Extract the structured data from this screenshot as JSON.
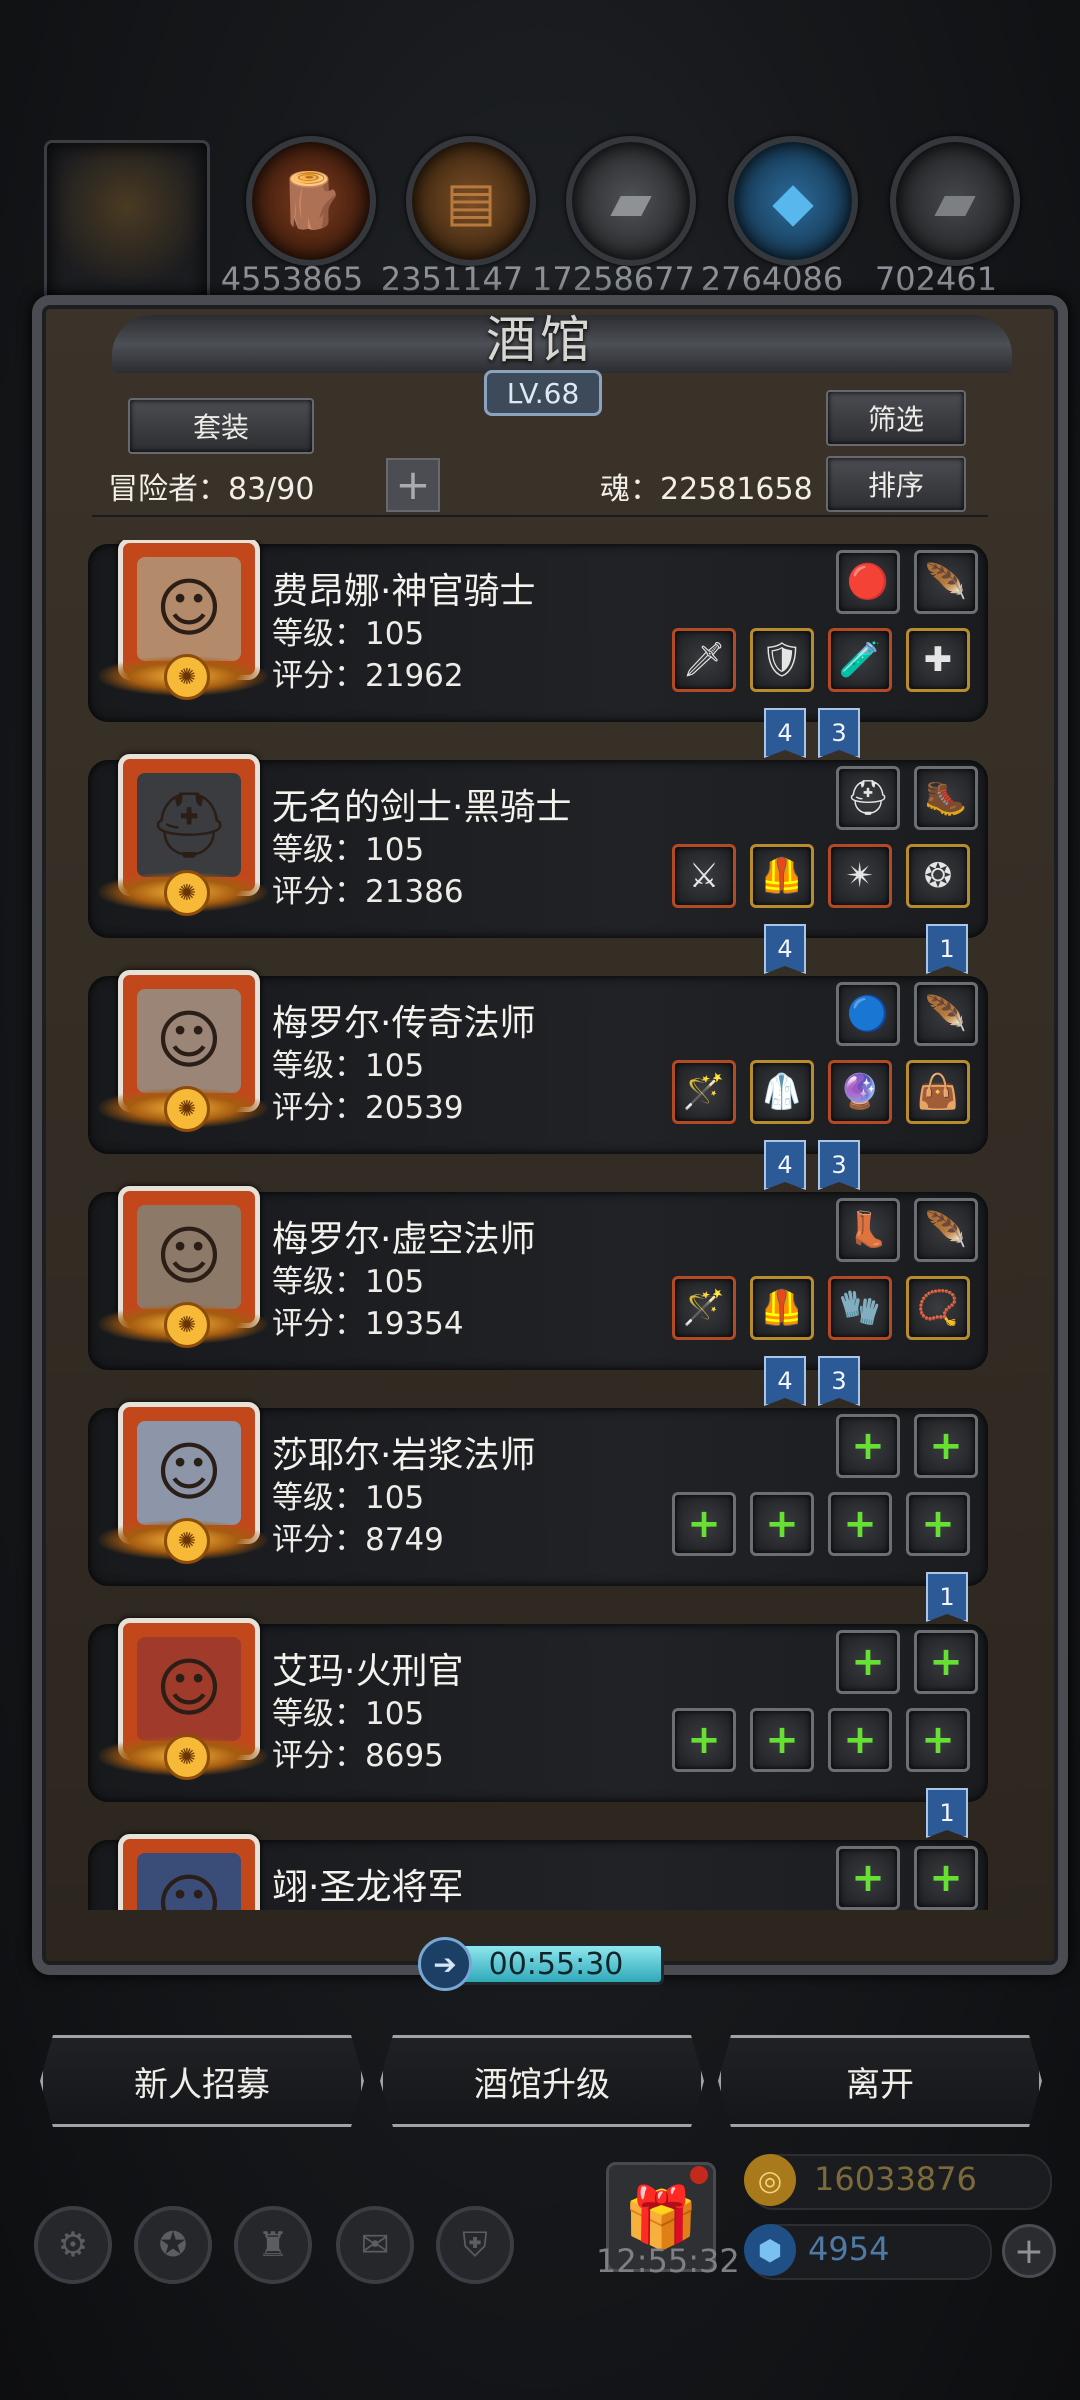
{
  "top_resources": [
    {
      "icon": "wood-icon",
      "glyph": "🪵",
      "value": "4553865"
    },
    {
      "icon": "plank-icon",
      "glyph": "▤",
      "value": "2351147"
    },
    {
      "icon": "iron-bar-icon",
      "glyph": "▰",
      "value": "17258677"
    },
    {
      "icon": "crystal-icon",
      "glyph": "◆",
      "value": "2764086"
    },
    {
      "icon": "steel-icon",
      "glyph": "▰",
      "value": "702461"
    }
  ],
  "tavern": {
    "title": "酒馆",
    "level": "LV.68",
    "set_button": "套装",
    "filter_button": "筛选",
    "sort_button": "排序",
    "adventurer_label": "冒险者：83/90",
    "soul_label": "魂：22581658"
  },
  "heroes": [
    {
      "name": "费昂娜·神官骑士",
      "level": "等级：105",
      "score": "评分：21962",
      "top_slots": [
        "🔴",
        "🪶",
        "💜"
      ],
      "bottom_slots": [
        "🗡",
        "🛡",
        "🧪",
        "✚"
      ],
      "tags": [
        "4",
        "3",
        ""
      ]
    },
    {
      "name": "无名的剑士·黑骑士",
      "level": "等级：105",
      "score": "评分：21386",
      "top_slots": [
        "⛑",
        "🥾",
        "🥾"
      ],
      "bottom_slots": [
        "⚔",
        "🦺",
        "✴",
        "❂"
      ],
      "tags": [
        "4",
        "",
        "1"
      ]
    },
    {
      "name": "梅罗尔·传奇法师",
      "level": "等级：105",
      "score": "评分：20539",
      "top_slots": [
        "🔵",
        "🪶",
        "🪶"
      ],
      "bottom_slots": [
        "🪄",
        "🥼",
        "🔮",
        "👜"
      ],
      "tags": [
        "4",
        "3",
        ""
      ]
    },
    {
      "name": "梅罗尔·虚空法师",
      "level": "等级：105",
      "score": "评分：19354",
      "top_slots": [
        "👢",
        "🪶",
        "✦"
      ],
      "bottom_slots": [
        "🪄",
        "🦺",
        "🧤",
        "📿"
      ],
      "tags": [
        "4",
        "3",
        ""
      ]
    },
    {
      "name": "莎耶尔·岩浆法师",
      "level": "等级：105",
      "score": "评分：8749",
      "top_slots": [
        "+",
        "+",
        "+"
      ],
      "bottom_slots": [
        "+",
        "+",
        "+",
        "+"
      ],
      "tags": [
        "",
        "",
        "1"
      ]
    },
    {
      "name": "艾玛·火刑官",
      "level": "等级：105",
      "score": "评分：8695",
      "top_slots": [
        "+",
        "+",
        "+"
      ],
      "bottom_slots": [
        "+",
        "+",
        "+",
        "+"
      ],
      "tags": [
        "",
        "",
        "1"
      ]
    },
    {
      "name": "翊·圣龙将军",
      "level": "",
      "score": "",
      "top_slots": [
        "+",
        "+",
        "+"
      ],
      "bottom_slots": [],
      "tags": [
        "",
        "",
        ""
      ]
    }
  ],
  "timer": "00:55:30",
  "buttons": {
    "recruit": "新人招募",
    "upgrade": "酒馆升级",
    "leave": "离开"
  },
  "dock": {
    "clock": "12:55:32",
    "gold": "16033876",
    "gems": "4954"
  },
  "colors": {
    "accent": "#2fa9b8",
    "gold": "#f7b938",
    "green_plus": "#66e033"
  }
}
